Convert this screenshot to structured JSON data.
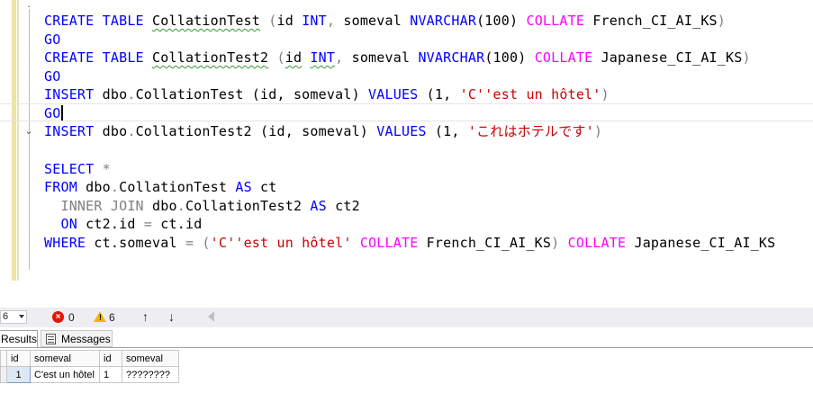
{
  "editor": {
    "lines": [
      {
        "kw1": "CREATE",
        "kw2": "TABLE",
        "name": "CollationTest",
        "p1": "(",
        "col1": "id",
        "type1": "INT",
        "comma": ",",
        "col2": "someval",
        "type2": "NVARCHAR",
        "num": "(100)",
        "coll": "COLLATE",
        "collname": "French_CI_AI_KS",
        "p2": ")"
      },
      {
        "go": "GO"
      },
      {
        "kw1": "CREATE",
        "kw2": "TABLE",
        "name": "CollationTest2",
        "p1": "(",
        "col1": "id",
        "type1": "INT",
        "comma": ",",
        "col2": "someval",
        "type2": "NVARCHAR",
        "num": "(100)",
        "coll": "COLLATE",
        "collname": "Japanese_CI_AI_KS",
        "p2": ")"
      },
      {
        "go": "GO"
      },
      {
        "kw": "INSERT",
        "obj": "dbo",
        "dot": ".",
        "tbl": "CollationTest",
        "cols": "(id, someval)",
        "vals": "VALUES",
        "open": "(1,",
        "str": "'C''est un hôtel'",
        "close": ")"
      },
      {
        "go": "GO"
      },
      {
        "kw": "INSERT",
        "obj": "dbo",
        "dot": ".",
        "tbl": "CollationTest2",
        "cols": "(id, someval)",
        "vals": "VALUES",
        "open": "(1,",
        "str": "'これはホテルです'",
        "close": ")"
      },
      {
        "select": "SELECT",
        "star": "*"
      },
      {
        "from": "FROM",
        "obj": "dbo",
        "dot": ".",
        "tbl": "CollationTest",
        "as": "AS",
        "alias": "ct"
      },
      {
        "join": "INNER JOIN",
        "obj": "dbo",
        "dot": ".",
        "tbl": "CollationTest2",
        "as": "AS",
        "alias": "ct2"
      },
      {
        "on": "ON",
        "lhs": "ct2.id",
        "eq": "=",
        "rhs": "ct.id"
      },
      {
        "where": "WHERE",
        "lhs": "ct.someval",
        "eq": "=",
        "open": "(",
        "str": "'C''est un hôtel'",
        "coll1": "COLLATE",
        "cn1": "French_CI_AI_KS",
        "close": ")",
        "coll2": "COLLATE",
        "cn2": "Japanese_CI_AI_KS"
      }
    ]
  },
  "status": {
    "zoom": "6",
    "errors": "0",
    "warnings": "6",
    "up_arrow": "↑",
    "down_arrow": "↓"
  },
  "tabs": {
    "results": "Results",
    "messages": "Messages"
  },
  "grid": {
    "headers": [
      "id",
      "someval",
      "id",
      "someval"
    ],
    "rows": [
      {
        "rownum": "1",
        "c1": "1",
        "c2": "C'est un hôtel",
        "c3": "1",
        "c4": "????????"
      }
    ]
  },
  "colors": {
    "keyword": "#0000ff",
    "function": "#ff00ff",
    "string": "#cc0000",
    "operator": "#808080",
    "error": "#e51400",
    "warning": "#f2b800"
  }
}
